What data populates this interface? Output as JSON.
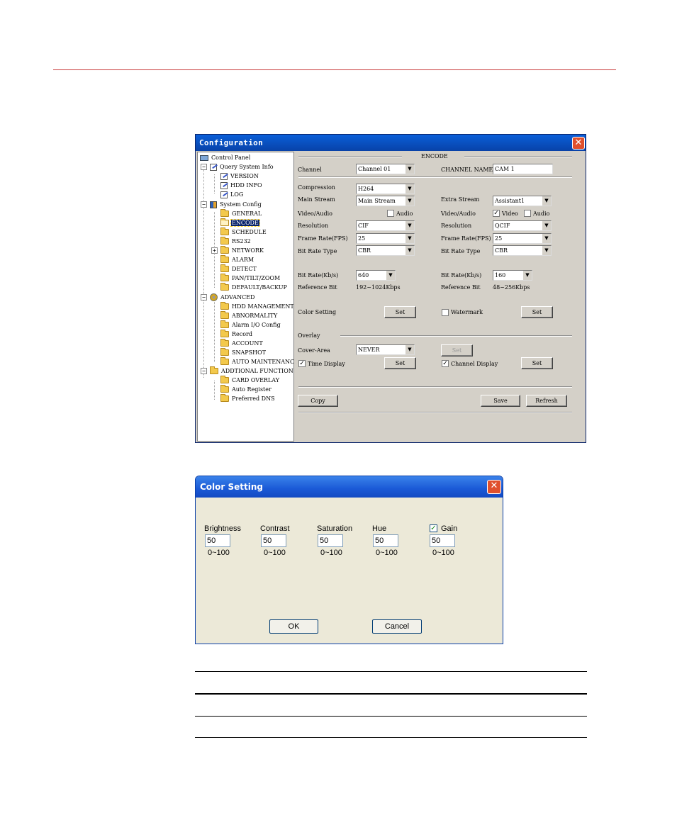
{
  "config": {
    "title": "Configuration",
    "close": "✕",
    "tree": [
      {
        "label": "Control Panel"
      },
      {
        "label": "Query System Info",
        "expander": "−"
      },
      {
        "label": "VERSION"
      },
      {
        "label": "HDD INFO"
      },
      {
        "label": "LOG"
      },
      {
        "label": "System Config",
        "expander": "−"
      },
      {
        "label": "GENERAL"
      },
      {
        "label": "ENCODE"
      },
      {
        "label": "SCHEDULE"
      },
      {
        "label": "RS232"
      },
      {
        "label": "NETWORK",
        "expander": "+"
      },
      {
        "label": "ALARM"
      },
      {
        "label": "DETECT"
      },
      {
        "label": "PAN/TILT/ZOOM"
      },
      {
        "label": "DEFAULT/BACKUP"
      },
      {
        "label": "ADVANCED",
        "expander": "−"
      },
      {
        "label": "HDD MANAGEMENT"
      },
      {
        "label": "ABNORMALITY"
      },
      {
        "label": "Alarm I/O Config"
      },
      {
        "label": "Record"
      },
      {
        "label": "ACCOUNT"
      },
      {
        "label": "SNAPSHOT"
      },
      {
        "label": "AUTO MAINTENANCE"
      },
      {
        "label": "ADDTIONAL FUNCTION",
        "expander": "−"
      },
      {
        "label": "CARD OVERLAY"
      },
      {
        "label": "Auto Register"
      },
      {
        "label": "Preferred DNS"
      }
    ],
    "encode": {
      "section_title": "ENCODE",
      "channel_label": "Channel",
      "channel_value": "Channel 01",
      "channel_name_label": "CHANNEL NAME",
      "channel_name_value": "CAM 1",
      "compression_label": "Compression",
      "compression_value": "H264",
      "main_stream_label": "Main Stream",
      "main_stream_value": "Main Stream",
      "extra_stream_label": "Extra Stream",
      "extra_stream_value": "Assistant1",
      "video_audio_label": "Video/Audio",
      "audio_label": "Audio",
      "audio_checked": false,
      "extra_video_audio_label": "Video/Audio",
      "video_label": "Video",
      "extra_video_checked": true,
      "extra_audio_label": "Audio",
      "extra_audio_checked": false,
      "resolution_label": "Resolution",
      "resolution_value": "CIF",
      "extra_resolution_label": "Resolution",
      "extra_resolution_value": "QCIF",
      "frame_rate_label": "Frame Rate(FPS)",
      "frame_rate_value": "25",
      "extra_frame_rate_label": "Frame Rate(FPS)",
      "extra_frame_rate_value": "25",
      "bit_rate_type_label": "Bit Rate Type",
      "bit_rate_type_value": "CBR",
      "extra_bit_rate_type_label": "Bit Rate Type",
      "extra_bit_rate_type_value": "CBR",
      "bit_rate_label": "Bit Rate(Kb/s)",
      "bit_rate_value": "640",
      "extra_bit_rate_label": "Bit Rate(Kb/s)",
      "extra_bit_rate_value": "160",
      "reference_bit_label": "Reference Bit",
      "reference_bit_value": "192~1024Kbps",
      "extra_reference_bit_label": "Reference Bit",
      "extra_reference_bit_value": "48~256Kbps",
      "color_setting_label": "Color Setting",
      "set_label": "Set",
      "watermark_label": "Watermark",
      "watermark_checked": false,
      "overlay_label": "Overlay",
      "cover_area_label": "Cover-Area",
      "cover_area_value": "NEVER",
      "time_display_label": "Time Display",
      "time_display_checked": true,
      "channel_display_label": "Channel Display",
      "channel_display_checked": true,
      "copy_label": "Copy",
      "save_label": "Save",
      "refresh_label": "Refresh",
      "dropdown_arrow": "▼",
      "check_mark": "✓"
    }
  },
  "color_setting": {
    "title": "Color Setting",
    "close": "✕",
    "fields": [
      {
        "label": "Brightness",
        "value": "50",
        "range": "0~100"
      },
      {
        "label": "Contrast",
        "value": "50",
        "range": "0~100"
      },
      {
        "label": "Saturation",
        "value": "50",
        "range": "0~100"
      },
      {
        "label": "Hue",
        "value": "50",
        "range": "0~100"
      },
      {
        "label": "Gain",
        "value": "50",
        "range": "0~100",
        "checked": true
      }
    ],
    "ok_label": "OK",
    "cancel_label": "Cancel",
    "check_mark": "✓"
  },
  "colors": {
    "page_rule": "#c83a3a",
    "xp_title": "#1a59d6",
    "classic_title": "#0842a8",
    "close_button": "#e0502d"
  }
}
